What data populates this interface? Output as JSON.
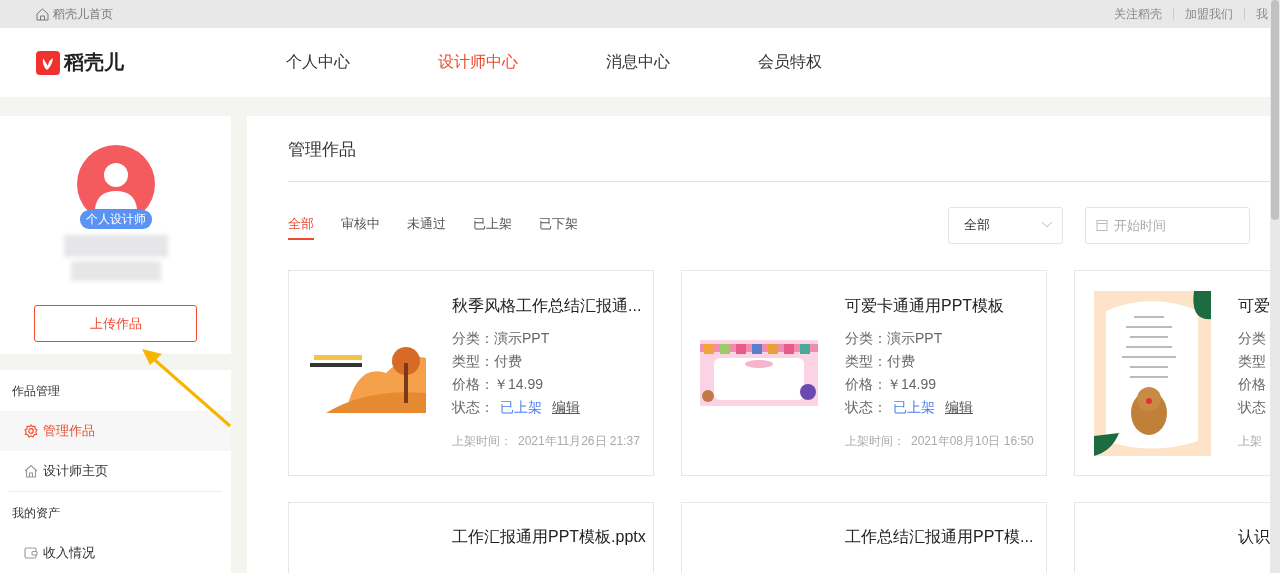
{
  "top_bar": {
    "home_link": "稻壳儿首页",
    "links": [
      "关注稻壳",
      "加盟我们",
      "我"
    ]
  },
  "header": {
    "logo": "稻壳儿",
    "nav": [
      {
        "label": "个人中心",
        "selected": false
      },
      {
        "label": "设计师中心",
        "selected": true
      },
      {
        "label": "消息中心",
        "selected": false
      },
      {
        "label": "会员特权",
        "selected": false
      }
    ]
  },
  "profile": {
    "badge": "个人设计师",
    "upload_button": "上传作品"
  },
  "sidebar": {
    "sections": [
      {
        "title": "作品管理",
        "items": [
          {
            "label": "管理作品",
            "kind": "gear",
            "selected": true
          },
          {
            "label": "设计师主页",
            "kind": "home",
            "selected": false
          }
        ]
      },
      {
        "title": "我的资产",
        "items": [
          {
            "label": "收入情况",
            "kind": "wallet",
            "selected": false
          }
        ]
      }
    ]
  },
  "main": {
    "title": "管理作品",
    "tabs": [
      {
        "label": "全部",
        "selected": true
      },
      {
        "label": "审核中",
        "selected": false
      },
      {
        "label": "未通过",
        "selected": false
      },
      {
        "label": "已上架",
        "selected": false
      },
      {
        "label": "已下架",
        "selected": false
      }
    ],
    "filter_select": {
      "value": "全部"
    },
    "date_field": {
      "placeholder": "开始时间"
    },
    "cards": [
      {
        "kind": "autumn",
        "title": "秋季风格工作总结汇报通...",
        "lines": [
          "分类：演示PPT",
          "类型：付费",
          "价格：￥14.99"
        ],
        "status": {
          "label": "状态：",
          "value": "已上架",
          "action": "编辑"
        },
        "time": {
          "label": "上架时间：",
          "value": "2021年11月26日 21:37"
        }
      },
      {
        "kind": "cartoon",
        "title": "可爱卡通通用PPT模板",
        "lines": [
          "分类：演示PPT",
          "类型：付费",
          "价格：￥14.99"
        ],
        "status": {
          "label": "状态：",
          "value": "已上架",
          "action": "编辑"
        },
        "time": {
          "label": "上架时间：",
          "value": "2021年08月10日 16:50"
        }
      },
      {
        "kind": "portrait",
        "title": "可爱",
        "lines": [
          "分类",
          "类型",
          "价格",
          "状态"
        ],
        "time": {
          "label": "上架"
        }
      },
      {
        "kind": "plain",
        "title": "工作汇报通用PPT模板.pptx"
      },
      {
        "kind": "plain",
        "title": "工作总结汇报通用PPT模..."
      },
      {
        "kind": "plain",
        "title": "认识"
      }
    ]
  }
}
